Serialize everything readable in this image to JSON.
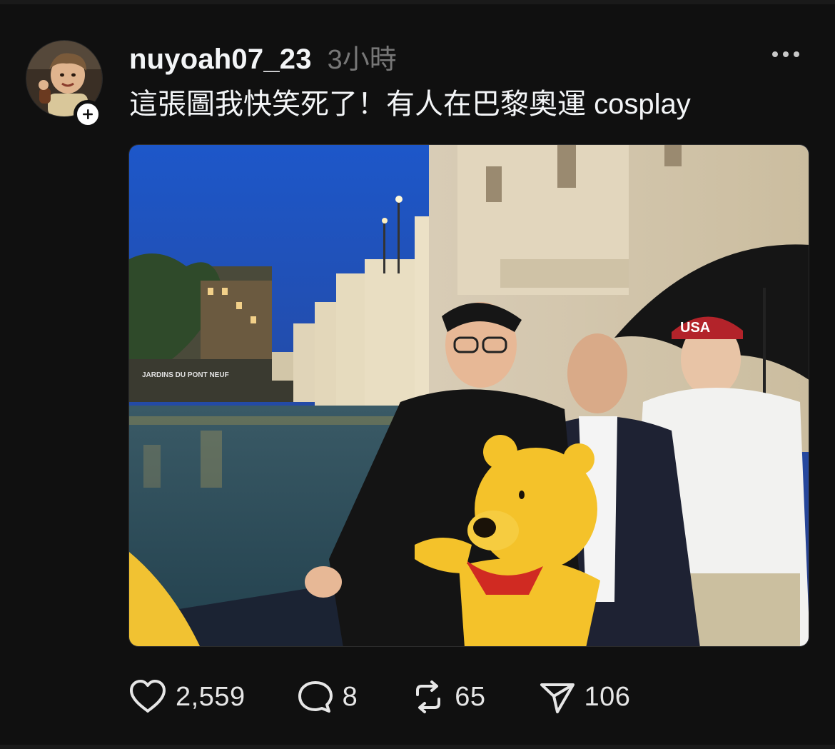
{
  "post": {
    "username": "nuyoah07_23",
    "timestamp": "3小時",
    "caption": "這張圖我快笑死了！有人在巴黎奧運 cosplay"
  },
  "photo": {
    "sign_text": "JARDINS DU PONT NEUF",
    "cap_text": "USA"
  },
  "icons": {
    "avatar": "avatar-photo",
    "follow": "plus-icon",
    "more": "more-horizontal-icon",
    "like": "heart-icon",
    "reply": "speech-bubble-icon",
    "repost": "repost-icon",
    "share": "paper-plane-icon"
  },
  "stats": {
    "likes": "2,559",
    "replies": "8",
    "reposts": "65",
    "shares": "106"
  },
  "colors": {
    "background": "#101010",
    "text": "#f3f5f7",
    "muted": "#777777"
  }
}
